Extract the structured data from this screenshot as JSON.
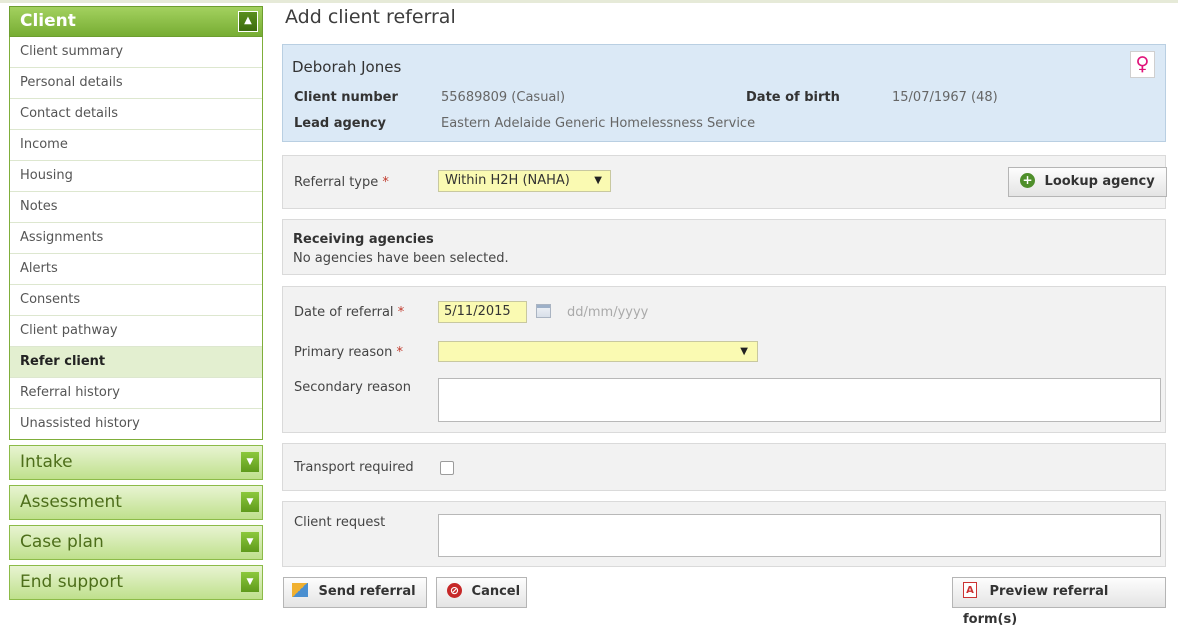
{
  "sidebar": {
    "client_header": "Client",
    "menu_items": [
      {
        "label": "Client summary"
      },
      {
        "label": "Personal details"
      },
      {
        "label": "Contact details"
      },
      {
        "label": "Income"
      },
      {
        "label": "Housing"
      },
      {
        "label": "Notes"
      },
      {
        "label": "Assignments"
      },
      {
        "label": "Alerts"
      },
      {
        "label": "Consents"
      },
      {
        "label": "Client pathway"
      },
      {
        "label": "Refer client",
        "active": true
      },
      {
        "label": "Referral history"
      },
      {
        "label": "Unassisted history"
      }
    ],
    "sections": [
      {
        "label": "Intake"
      },
      {
        "label": "Assessment"
      },
      {
        "label": "Case plan"
      },
      {
        "label": "End support"
      }
    ]
  },
  "page": {
    "title": "Add client referral"
  },
  "client": {
    "name": "Deborah Jones",
    "gender_symbol": "♀",
    "gender_icon": "female-icon",
    "client_number_label": "Client number",
    "client_number": "55689809 (Casual)",
    "dob_label": "Date of birth",
    "dob": "15/07/1967 (48)",
    "lead_agency_label": "Lead agency",
    "lead_agency": "Eastern Adelaide Generic Homelessness Service"
  },
  "referral": {
    "type_label": "Referral type",
    "required_mark": "*",
    "type_value": "Within H2H (NAHA)",
    "lookup_label": "Lookup agency"
  },
  "receiving": {
    "title": "Receiving agencies",
    "empty_text": "No agencies have been selected."
  },
  "details": {
    "date_label": "Date of referral",
    "date_value": "5/11/2015",
    "date_format": "dd/mm/yyyy",
    "primary_label": "Primary reason",
    "primary_value": "",
    "secondary_label": "Secondary reason",
    "secondary_value": ""
  },
  "transport": {
    "label": "Transport required",
    "checked": false
  },
  "request": {
    "label": "Client request",
    "value": ""
  },
  "actions": {
    "send": "Send referral",
    "cancel": "Cancel",
    "preview": "Preview referral form(s)"
  },
  "colors": {
    "green": "#77ad33",
    "yellow_field": "#fafab2",
    "client_bg": "#dbe9f6",
    "female": "#e0137a"
  }
}
